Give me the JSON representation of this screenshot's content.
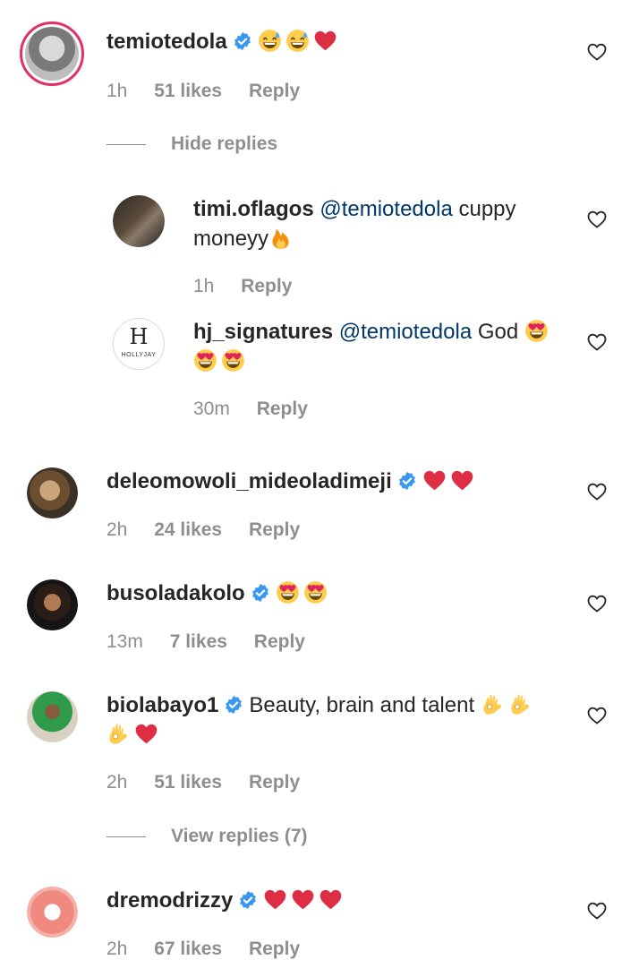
{
  "comments": [
    {
      "username": "temiotedola",
      "verified": true,
      "text": "",
      "emojis": [
        "grin-sweat",
        "grin-sweat",
        "red-heart"
      ],
      "time": "1h",
      "likes": "51 likes",
      "reply": "Reply"
    },
    {
      "username": "deleomowoli_mideoladimeji",
      "verified": true,
      "text": "",
      "emojis": [
        "red-heart",
        "red-heart"
      ],
      "time": "2h",
      "likes": "24 likes",
      "reply": "Reply"
    },
    {
      "username": "busoladakolo",
      "verified": true,
      "text": "",
      "emojis": [
        "heart-eyes",
        "heart-eyes"
      ],
      "time": "13m",
      "likes": "7 likes",
      "reply": "Reply"
    },
    {
      "username": "biolabayo1",
      "verified": true,
      "text": "Beauty, brain and talent",
      "emojis": [
        "ok-hand",
        "ok-hand",
        "ok-hand",
        "red-heart"
      ],
      "time": "2h",
      "likes": "51 likes",
      "reply": "Reply"
    },
    {
      "username": "dremodrizzy",
      "verified": true,
      "text": "",
      "emojis": [
        "red-heart",
        "red-heart",
        "red-heart"
      ],
      "time": "2h",
      "likes": "67 likes",
      "reply": "Reply"
    }
  ],
  "replies": [
    {
      "username": "timi.oflagos",
      "mention": "@temiotedola",
      "text": "cuppy",
      "text2": "moneyy",
      "emojis": [
        "fire"
      ],
      "time": "1h",
      "reply": "Reply"
    },
    {
      "username": "hj_signatures",
      "mention": "@temiotedola",
      "text": "God",
      "emojis": [
        "heart-eyes",
        "heart-eyes",
        "heart-eyes"
      ],
      "time": "30m",
      "reply": "Reply",
      "avatar_logo": "H",
      "avatar_brand": "HOLLYJAY"
    }
  ],
  "hide_replies": "Hide replies",
  "view_replies": "View replies (7)",
  "colors": {
    "mention": "#00376b",
    "meta": "#8e8e8e",
    "verified": "#3897f0",
    "heart": "#e0245e"
  }
}
